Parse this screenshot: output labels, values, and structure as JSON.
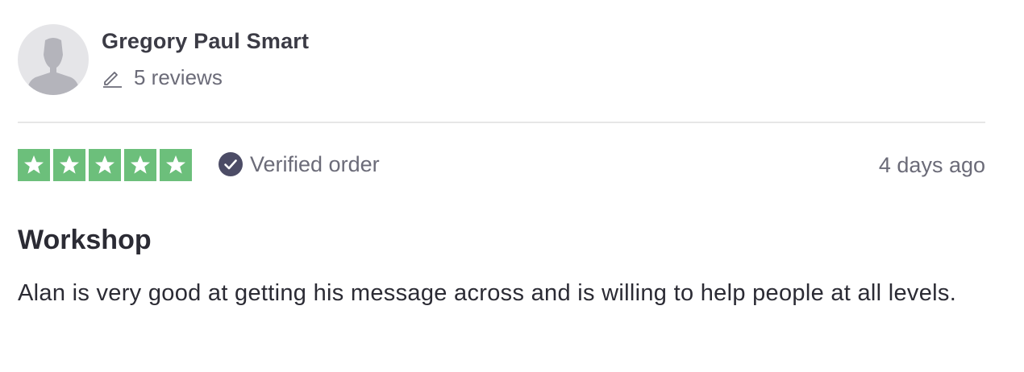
{
  "consumer": {
    "name": "Gregory Paul Smart",
    "reviews_count": "5 reviews",
    "avatar_icon": "person-silhouette-icon",
    "reviews_icon": "pencil-icon"
  },
  "review": {
    "rating": 5,
    "rating_max": 5,
    "star_color": "#6cbf7b",
    "verified_label": "Verified order",
    "verified_icon": "check-circle-icon",
    "date": "4 days ago",
    "title": "Workshop",
    "text": "Alan is very good at getting his message across and is willing to help people at all levels."
  }
}
